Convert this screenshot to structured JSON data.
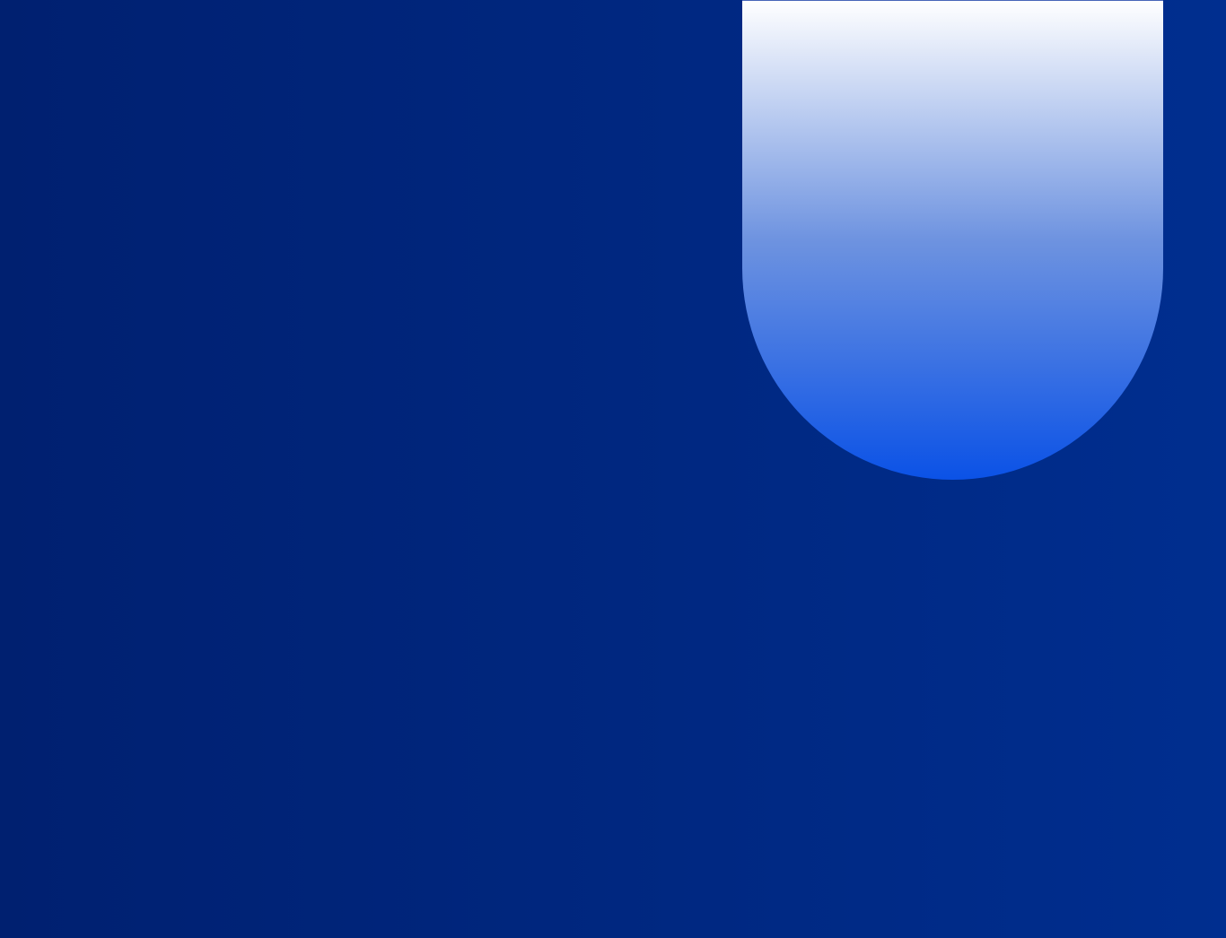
{
  "colors": {
    "background_left": "#002070",
    "background_right": "#002E8F",
    "shape_top": "#FFFFFF",
    "shape_mid": "#6E93E0",
    "shape_bottom": "#0B52E6",
    "shape_edge": "#4766B8"
  },
  "shapes": [
    {
      "name": "gradient-pill-shape"
    }
  ]
}
